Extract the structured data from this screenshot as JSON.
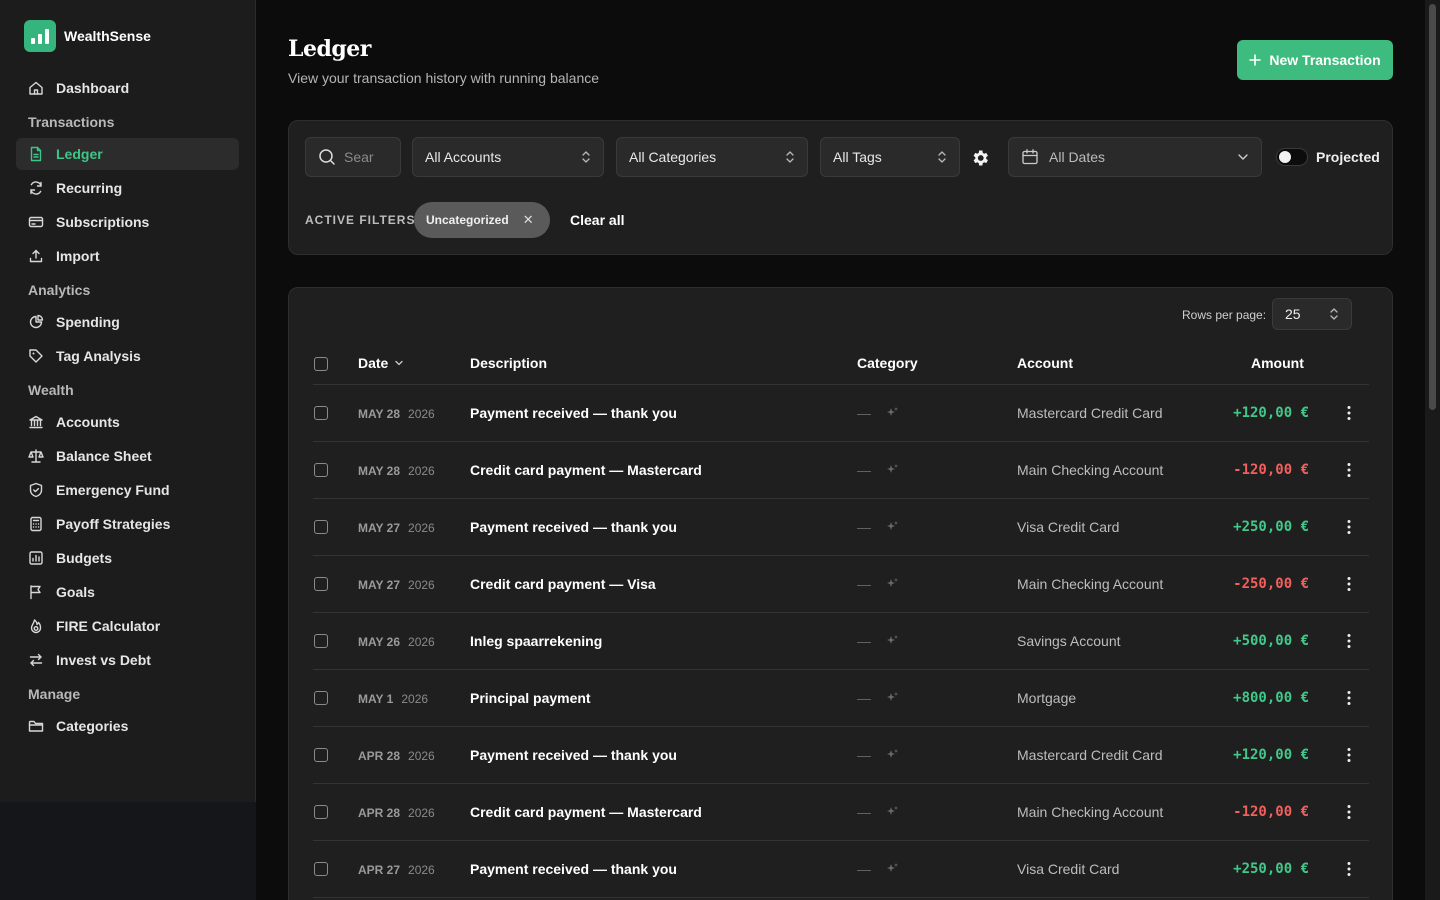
{
  "brand": {
    "name": "WealthSense"
  },
  "sidebar": {
    "items": [
      {
        "type": "item",
        "label": "Dashboard",
        "icon": "home-icon"
      },
      {
        "type": "section",
        "label": "Transactions"
      },
      {
        "type": "item",
        "label": "Ledger",
        "icon": "file-icon",
        "active": true
      },
      {
        "type": "item",
        "label": "Recurring",
        "icon": "refresh-icon"
      },
      {
        "type": "item",
        "label": "Subscriptions",
        "icon": "credit-card-icon"
      },
      {
        "type": "item",
        "label": "Import",
        "icon": "upload-icon"
      },
      {
        "type": "section",
        "label": "Analytics"
      },
      {
        "type": "item",
        "label": "Spending",
        "icon": "pie-chart-icon"
      },
      {
        "type": "item",
        "label": "Tag Analysis",
        "icon": "tag-icon"
      },
      {
        "type": "section",
        "label": "Wealth"
      },
      {
        "type": "item",
        "label": "Accounts",
        "icon": "bank-icon"
      },
      {
        "type": "item",
        "label": "Balance Sheet",
        "icon": "scale-icon"
      },
      {
        "type": "item",
        "label": "Emergency Fund",
        "icon": "shield-icon"
      },
      {
        "type": "item",
        "label": "Payoff Strategies",
        "icon": "calculator-icon"
      },
      {
        "type": "item",
        "label": "Budgets",
        "icon": "budget-chart-icon"
      },
      {
        "type": "item",
        "label": "Goals",
        "icon": "flag-icon"
      },
      {
        "type": "item",
        "label": "FIRE Calculator",
        "icon": "flame-icon"
      },
      {
        "type": "item",
        "label": "Invest vs Debt",
        "icon": "swap-icon"
      },
      {
        "type": "section",
        "label": "Manage"
      },
      {
        "type": "item",
        "label": "Categories",
        "icon": "folder-icon"
      }
    ]
  },
  "header": {
    "title": "Ledger",
    "subtitle": "View your transaction history with running balance",
    "new_button": "New Transaction"
  },
  "filters": {
    "search_placeholder": "Search",
    "accounts": "All Accounts",
    "categories": "All Categories",
    "tags": "All Tags",
    "dates": "All Dates",
    "projected_label": "Projected",
    "projected_on": false,
    "active_label": "ACTIVE FILTERS:",
    "active_chip": "Uncategorized",
    "clear_all": "Clear all"
  },
  "table": {
    "rows_per_page_label": "Rows per page:",
    "rows_per_page": "25",
    "columns": {
      "date": "Date",
      "description": "Description",
      "category": "Category",
      "account": "Account",
      "amount": "Amount"
    },
    "category_placeholder": "—",
    "rows": [
      {
        "date": "MAY 28",
        "year": "2026",
        "description": "Payment received — thank you",
        "account": "Mastercard Credit Card",
        "amount": "+120,00 €",
        "sign": "pos"
      },
      {
        "date": "MAY 28",
        "year": "2026",
        "description": "Credit card payment — Mastercard",
        "account": "Main Checking Account",
        "amount": "-120,00 €",
        "sign": "neg"
      },
      {
        "date": "MAY 27",
        "year": "2026",
        "description": "Payment received — thank you",
        "account": "Visa Credit Card",
        "amount": "+250,00 €",
        "sign": "pos"
      },
      {
        "date": "MAY 27",
        "year": "2026",
        "description": "Credit card payment — Visa",
        "account": "Main Checking Account",
        "amount": "-250,00 €",
        "sign": "neg"
      },
      {
        "date": "MAY 26",
        "year": "2026",
        "description": "Inleg spaarrekening",
        "account": "Savings Account",
        "amount": "+500,00 €",
        "sign": "pos"
      },
      {
        "date": "MAY 1",
        "year": "2026",
        "description": "Principal payment",
        "account": "Mortgage",
        "amount": "+800,00 €",
        "sign": "pos"
      },
      {
        "date": "APR 28",
        "year": "2026",
        "description": "Payment received — thank you",
        "account": "Mastercard Credit Card",
        "amount": "+120,00 €",
        "sign": "pos"
      },
      {
        "date": "APR 28",
        "year": "2026",
        "description": "Credit card payment — Mastercard",
        "account": "Main Checking Account",
        "amount": "-120,00 €",
        "sign": "neg"
      },
      {
        "date": "APR 27",
        "year": "2026",
        "description": "Payment received — thank you",
        "account": "Visa Credit Card",
        "amount": "+250,00 €",
        "sign": "pos"
      }
    ]
  },
  "colors": {
    "accent": "#3ebb7e",
    "positive": "#41c98a",
    "negative": "#f0605c",
    "background": "#0c0c0c",
    "surface": "#1f1f1f"
  }
}
